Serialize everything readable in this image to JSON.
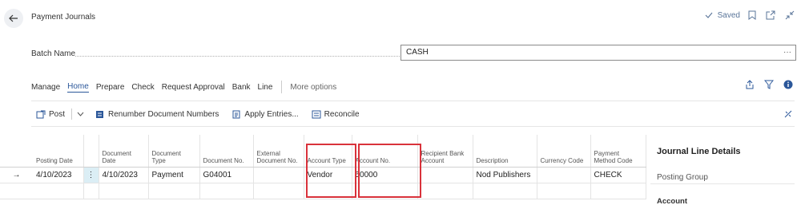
{
  "page": {
    "title": "Payment Journals",
    "status": "Saved"
  },
  "batch": {
    "label": "Batch Name",
    "value": "CASH"
  },
  "menu": {
    "items": [
      "Manage",
      "Home",
      "Prepare",
      "Check",
      "Request Approval",
      "Bank",
      "Line"
    ],
    "more": "More options"
  },
  "actions": {
    "post": "Post",
    "renumber": "Renumber Document Numbers",
    "apply": "Apply Entries...",
    "reconcile": "Reconcile"
  },
  "columns": {
    "posting_date": "Posting Date",
    "document_date": "Document Date",
    "document_type": "Document Type",
    "document_no": "Document No.",
    "external_document_no": "External Document No.",
    "account_type": "Account Type",
    "account_no": "Account No.",
    "recipient_bank_account": "Recipient Bank Account",
    "description": "Description",
    "currency_code": "Currency Code",
    "payment_method_code": "Payment Method Code"
  },
  "row": {
    "posting_date": "4/10/2023",
    "document_date": "4/10/2023",
    "document_type": "Payment",
    "document_no": "G04001",
    "external_document_no": "",
    "account_type": "Vendor",
    "account_no": "50000",
    "recipient_bank_account": "",
    "description": "Nod Publishers",
    "currency_code": "",
    "payment_method_code": "CHECK"
  },
  "details": {
    "title": "Journal Line Details",
    "posting_group": "Posting Group",
    "account": "Account"
  },
  "colors": {
    "accent": "#2b579a",
    "highlight": "#d9323b",
    "selected_cell": "#dbeef5"
  }
}
